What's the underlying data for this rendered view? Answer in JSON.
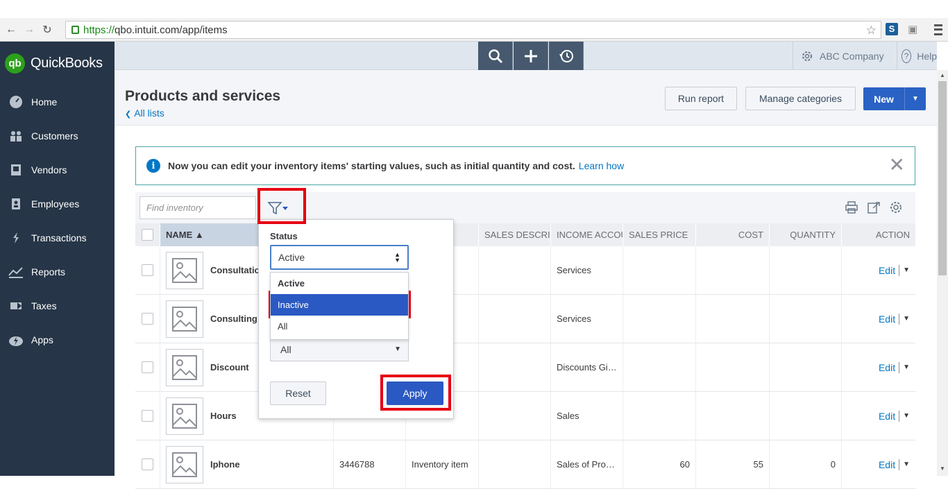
{
  "browser": {
    "url_protocol": "https://",
    "url_rest": "qbo.intuit.com/app/items",
    "ext_label": "S"
  },
  "sidebar": {
    "logo_mark": "qb",
    "logo_text": "QuickBooks",
    "items": [
      {
        "label": "Home",
        "icon": "dashboard-icon"
      },
      {
        "label": "Customers",
        "icon": "customers-icon"
      },
      {
        "label": "Vendors",
        "icon": "vendors-icon"
      },
      {
        "label": "Employees",
        "icon": "employees-icon"
      },
      {
        "label": "Transactions",
        "icon": "transactions-icon"
      },
      {
        "label": "Reports",
        "icon": "reports-icon"
      },
      {
        "label": "Taxes",
        "icon": "taxes-icon"
      },
      {
        "label": "Apps",
        "icon": "apps-icon"
      }
    ]
  },
  "header": {
    "company": "ABC Company",
    "help": "Help"
  },
  "page": {
    "title": "Products and services",
    "back_link": "All lists",
    "run_report": "Run report",
    "manage_categories": "Manage categories",
    "new_label": "New"
  },
  "banner": {
    "text": "Now you can edit your inventory items' starting values, such as initial quantity and cost.",
    "link": "Learn how"
  },
  "search": {
    "placeholder": "Find inventory"
  },
  "table": {
    "headers": [
      "NAME ▲",
      "",
      "",
      "SALES DESCRIP",
      "INCOME ACCOU",
      "SALES PRICE",
      "COST",
      "QUANTITY",
      "ACTION"
    ],
    "edit_label": "Edit",
    "rows": [
      {
        "name": "Consultatio",
        "sku": "",
        "type": "",
        "desc": "",
        "income": "Services",
        "price": "",
        "cost": "",
        "qty": ""
      },
      {
        "name": "Consulting",
        "sku": "",
        "type": "",
        "desc": "",
        "income": "Services",
        "price": "",
        "cost": "",
        "qty": ""
      },
      {
        "name": "Discount",
        "sku": "",
        "type": "",
        "desc": "",
        "income": "Discounts Gi…",
        "price": "",
        "cost": "",
        "qty": ""
      },
      {
        "name": "Hours",
        "sku": "",
        "type": "",
        "desc": "",
        "income": "Sales",
        "price": "",
        "cost": "",
        "qty": ""
      },
      {
        "name": "Iphone",
        "sku": "3446788",
        "type": "Inventory item",
        "desc": "",
        "income": "Sales of Pro…",
        "price": "60",
        "cost": "55",
        "qty": "0"
      }
    ]
  },
  "filter": {
    "status_label": "Status",
    "selected": "Active",
    "options": [
      "Active",
      "Inactive",
      "All"
    ],
    "second_value": "All",
    "reset": "Reset",
    "apply": "Apply"
  },
  "colors": {
    "sidebar": "#263547",
    "primary_blue": "#2b59c3",
    "link": "#0077c5",
    "highlight_red": "#e60012"
  }
}
